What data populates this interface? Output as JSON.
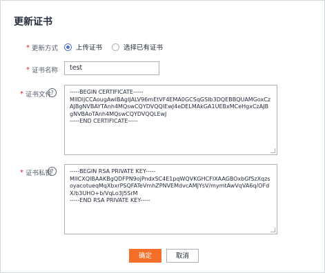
{
  "dialog": {
    "title": "更新证书",
    "fields": {
      "update_method": {
        "label": "更新方式",
        "options": [
          {
            "label": "上传证书",
            "selected": true
          },
          {
            "label": "选择已有证书",
            "selected": false
          }
        ]
      },
      "cert_name": {
        "label": "证书名称",
        "value": "test"
      },
      "cert_file": {
        "label": "证书文件",
        "lines": [
          "-----BEGIN CERTIFICATE-----",
          "MIIDIjCCAougAwIBAgIJALV96mEtVF4EMA0GCSqGSIb3DQEBBQUAMGoxCzAJBgNVBAYTAnh4MQswCQYDVQQIEwJ4eDELMAkGA1UEBxMCeHgxCzAJBgNVBAoTAnh4MQswCQYDVQQLEwJ",
          "-----END CERTIFICATE-----"
        ]
      },
      "private_key": {
        "label": "证书私钥",
        "lines": [
          "-----BEGIN RSA PRIVATE KEY-----",
          "MIICXQIBAAKBgQDFPN9ojPndxSC4E1pqWQVKGHCFIXAAGBOxbGfSzXqzsoyacotueqMqXbxrPSQFATeVmhZPNVEMdvcAMJYsV/mymtAwVqVA6q/OFdX/b3UHO+b/VqLo3J5SrM",
          "-----END RSA PRIVATE KEY-----"
        ]
      }
    },
    "buttons": {
      "confirm": "确定",
      "cancel": "取消"
    },
    "colors": {
      "primary": "#f66f2a",
      "radio_selected": "#526ecc",
      "required": "#e02020"
    }
  }
}
